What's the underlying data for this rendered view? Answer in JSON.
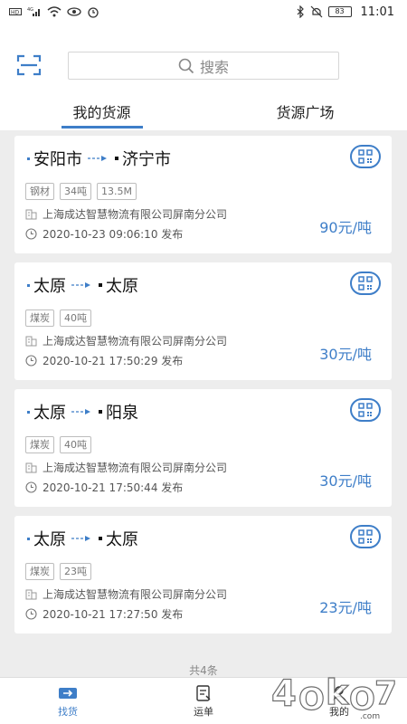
{
  "status_bar": {
    "battery": "83",
    "time": "11:01",
    "network": "4G"
  },
  "search": {
    "placeholder": "搜索"
  },
  "tabs": [
    {
      "label": "我的货源",
      "active": true
    },
    {
      "label": "货源广场",
      "active": false
    }
  ],
  "cards": [
    {
      "from": "安阳市",
      "to": "济宁市",
      "tags": [
        "钢材",
        "34吨",
        "13.5M"
      ],
      "company": "上海成达智慧物流有限公司屏南分公司",
      "time": "2020-10-23 09:06:10 发布",
      "price": "90元/吨"
    },
    {
      "from": "太原",
      "to": "太原",
      "tags": [
        "煤炭",
        "40吨"
      ],
      "company": "上海成达智慧物流有限公司屏南分公司",
      "time": "2020-10-21 17:50:29 发布",
      "price": "30元/吨"
    },
    {
      "from": "太原",
      "to": "阳泉",
      "tags": [
        "煤炭",
        "40吨"
      ],
      "company": "上海成达智慧物流有限公司屏南分公司",
      "time": "2020-10-21 17:50:44 发布",
      "price": "30元/吨"
    },
    {
      "from": "太原",
      "to": "太原",
      "tags": [
        "煤炭",
        "23吨"
      ],
      "company": "上海成达智慧物流有限公司屏南分公司",
      "time": "2020-10-21 17:27:50 发布",
      "price": "23元/吨"
    }
  ],
  "total_label": "共4条",
  "bottom_nav": [
    {
      "label": "找货",
      "icon": "truck-icon",
      "active": true
    },
    {
      "label": "运单",
      "icon": "waybill-icon",
      "active": false
    },
    {
      "label": "我的",
      "icon": "user-icon",
      "active": false
    }
  ],
  "colors": {
    "accent": "#3e7ec8",
    "background": "#ededed"
  },
  "watermark": "4OkO7.com"
}
